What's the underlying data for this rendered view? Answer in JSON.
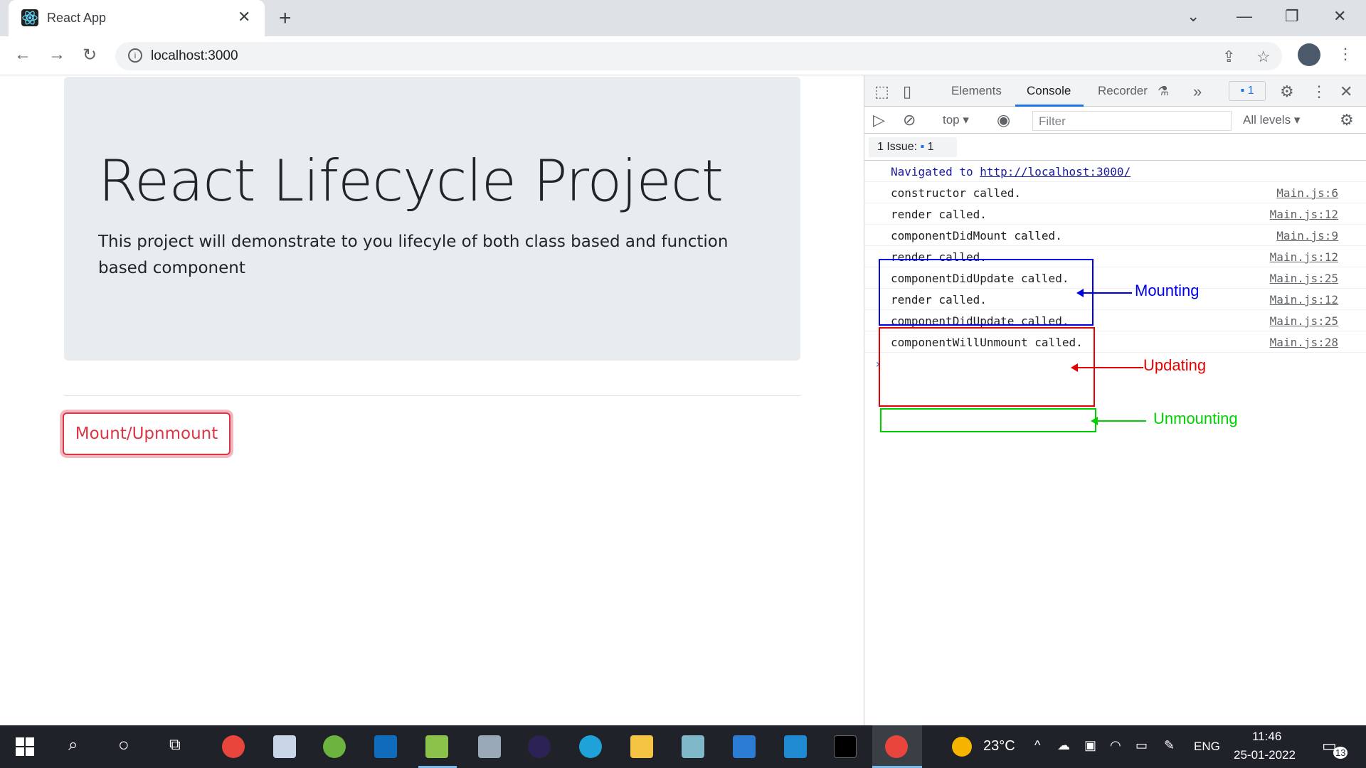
{
  "browser": {
    "tab_title": "React App",
    "url": "localhost:3000"
  },
  "page": {
    "heading": "React Lifecycle Project",
    "lead": "This project will demonstrate to you lifecyle of both class based and function based component",
    "button_label": "Mount/Upnmount"
  },
  "devtools": {
    "tabs": [
      "Elements",
      "Console",
      "Recorder"
    ],
    "active_tab": "Console",
    "issues_count": "1",
    "context": "top",
    "filter_placeholder": "Filter",
    "levels": "All levels",
    "issue_chip_label": "1 Issue:",
    "issue_chip_count": "1",
    "navigated_text": "Navigated to",
    "navigated_url": "http://localhost:3000/",
    "logs": [
      {
        "msg": "constructor called.",
        "src": "Main.js:6"
      },
      {
        "msg": "render called.",
        "src": "Main.js:12"
      },
      {
        "msg": "componentDidMount called.",
        "src": "Main.js:9"
      },
      {
        "msg": "render called.",
        "src": "Main.js:12"
      },
      {
        "msg": "componentDidUpdate called.",
        "src": "Main.js:25"
      },
      {
        "msg": "render called.",
        "src": "Main.js:12"
      },
      {
        "msg": "componentDidUpdate called.",
        "src": "Main.js:25"
      },
      {
        "msg": "componentWillUnmount called.",
        "src": "Main.js:28"
      }
    ],
    "annotations": {
      "mounting": "Mounting",
      "updating": "Updating",
      "unmounting": "Unmounting"
    },
    "colors": {
      "mounting": "#0000e6",
      "updating": "#e60000",
      "unmounting": "#00d000"
    }
  },
  "taskbar": {
    "weather": "23°C",
    "lang": "ENG",
    "time": "11:46",
    "date": "25-01-2022",
    "notifications": "13"
  }
}
